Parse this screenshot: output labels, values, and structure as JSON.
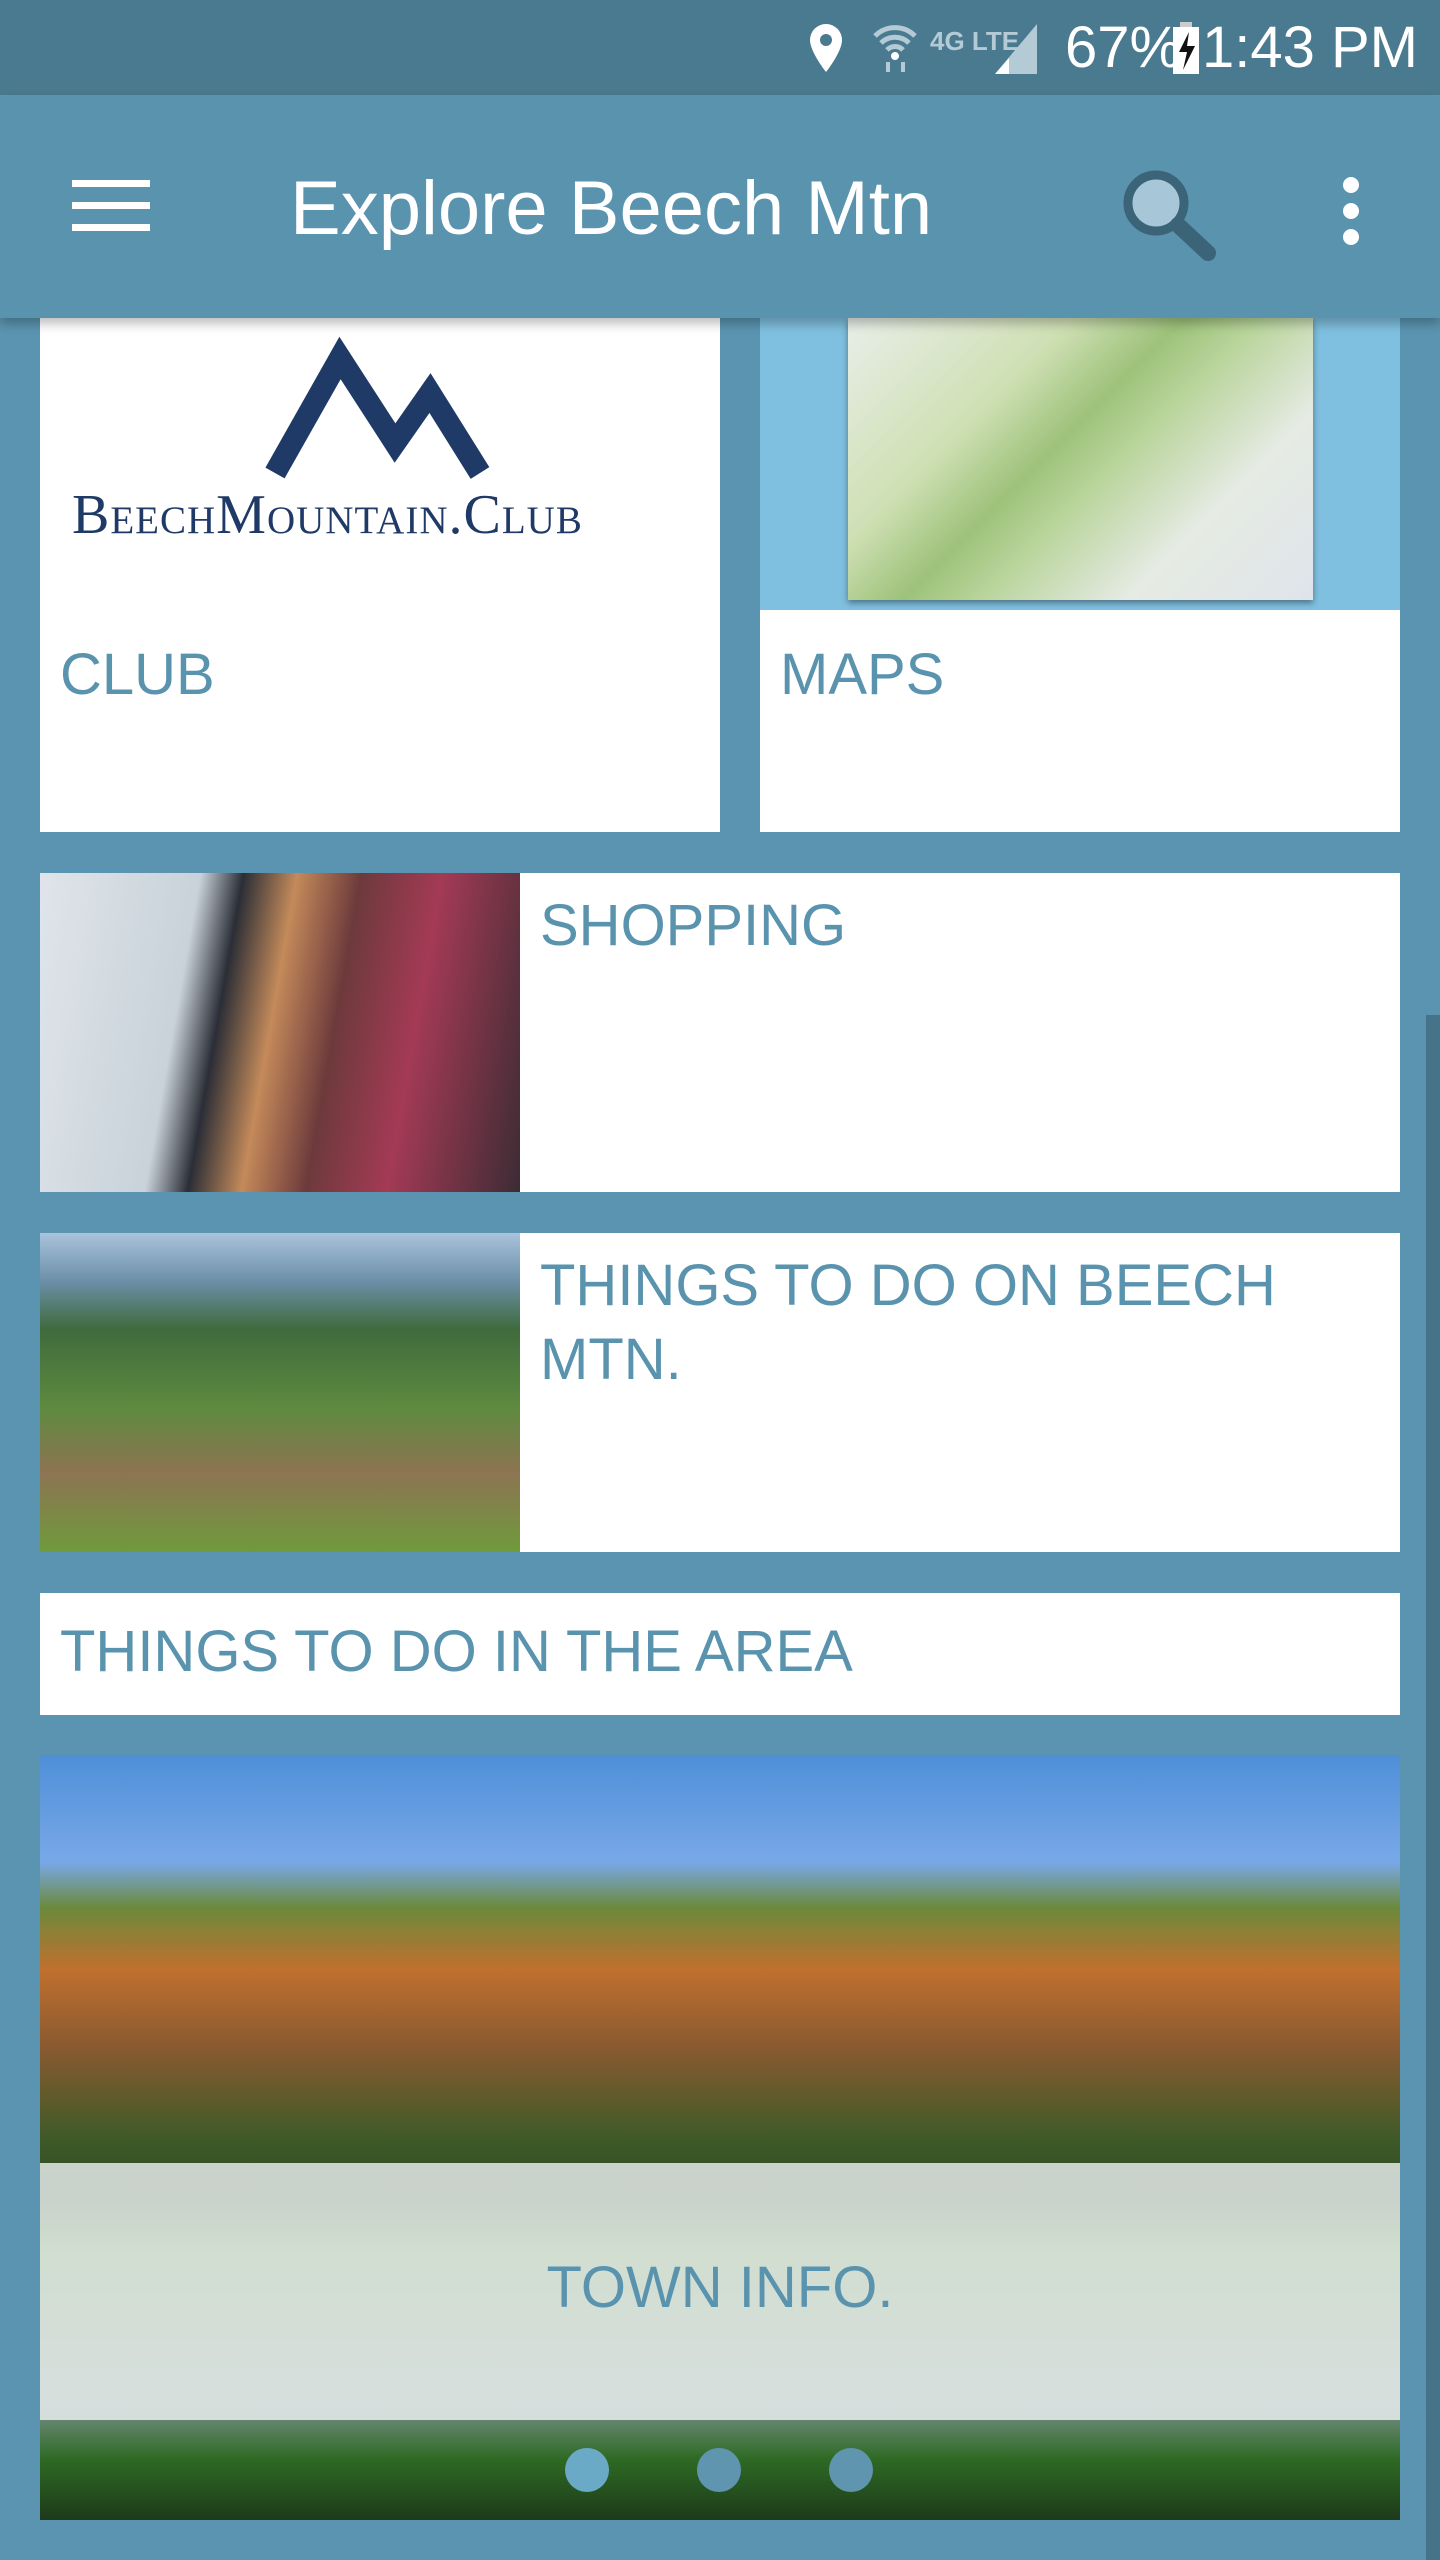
{
  "status_bar": {
    "battery": "67%",
    "time": "1:43 PM",
    "network": "4G LTE",
    "icons": [
      "location-icon",
      "wifi-icon",
      "lte-icon",
      "signal-icon",
      "battery-charging-icon"
    ]
  },
  "app_bar": {
    "title": "Explore Beech Mtn",
    "menu_icon": "hamburger-icon",
    "search_icon": "search-icon",
    "more_icon": "more-vert-icon"
  },
  "tiles": {
    "club": {
      "label": "CLUB",
      "logo": "BeechMountain.Club"
    },
    "maps": {
      "label": "MAPS"
    },
    "shopping": {
      "label": "SHOPPING"
    },
    "things_beech": {
      "label": "THINGS TO DO ON BEECH MTN."
    },
    "things_area": {
      "label": "THINGS TO DO IN THE AREA"
    },
    "town_info": {
      "label": "TOWN INFO.",
      "pages": 3,
      "active_page": 1
    }
  },
  "colors": {
    "accent": "#5a93ae",
    "status_bar": "#4a7a8f",
    "logo": "#1f3a66"
  }
}
